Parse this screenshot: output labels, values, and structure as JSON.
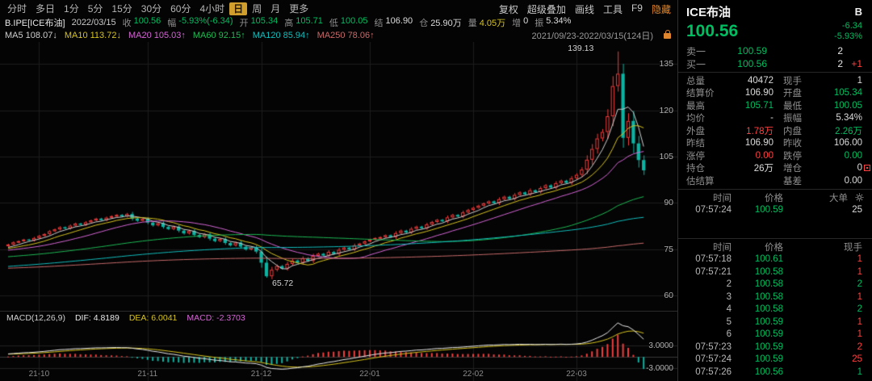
{
  "palette": {
    "up": "#ff4040",
    "down": "#00bd62",
    "flat": "#dcdcdc",
    "warn": "#d7c31f",
    "up_candle": "#f23c3c",
    "down_candle": "#0db3a2",
    "ma5": "#cfcfcf",
    "ma10": "#d7c31f",
    "ma20": "#d465d4",
    "ma60": "#1db954",
    "ma120": "#12bdbd",
    "ma250": "#c66a6a",
    "active_tab_bg": "#cf9e2c",
    "orange": "#e0862e"
  },
  "toolbar": {
    "tabs": [
      "分时",
      "多日",
      "1分",
      "5分",
      "15分",
      "30分",
      "60分",
      "4小时",
      "日",
      "周",
      "月",
      "更多"
    ],
    "active_tab": "日",
    "tools": [
      "复权",
      "超级叠加",
      "画线",
      "工具",
      "F9"
    ],
    "hide_label": "隐藏"
  },
  "infobar": {
    "code": "B.IPE[ICE布油]",
    "date": "2022/03/15",
    "fields": [
      {
        "l": "收",
        "v": "100.56",
        "c": "down"
      },
      {
        "l": "幅",
        "v": "-5.93%(-6.34)",
        "c": "down"
      },
      {
        "l": "开",
        "v": "105.34",
        "c": "down"
      },
      {
        "l": "高",
        "v": "105.71",
        "c": "down"
      },
      {
        "l": "低",
        "v": "100.05",
        "c": "down"
      },
      {
        "l": "结",
        "v": "106.90",
        "c": "flat"
      },
      {
        "l": "仓",
        "v": "25.90万",
        "c": "flat"
      },
      {
        "l": "量",
        "v": "4.05万",
        "c": "warn"
      },
      {
        "l": "增",
        "v": "0",
        "c": "flat"
      },
      {
        "l": "振",
        "v": "5.34%",
        "c": "flat"
      }
    ]
  },
  "ma_row": {
    "items": [
      {
        "label": "MA5",
        "value": "108.07↓",
        "color": "#cfcfcf"
      },
      {
        "label": "MA10",
        "value": "113.72↓",
        "color": "#d7c31f"
      },
      {
        "label": "MA20",
        "value": "105.03↑",
        "color": "#d465d4"
      },
      {
        "label": "MA60",
        "value": "92.15↑",
        "color": "#1db954"
      },
      {
        "label": "MA120",
        "value": "85.94↑",
        "color": "#12bdbd"
      },
      {
        "label": "MA250",
        "value": "78.06↑",
        "color": "#c66a6a"
      }
    ],
    "range": "2021/09/23-2022/03/15(124日)"
  },
  "macd": {
    "title": "MACD(12,26,9)",
    "dif_label": "DIF: 4.8189",
    "dea_label": "DEA: 6.0041",
    "macd_label": "MACD: -2.3703"
  },
  "chart_data": {
    "type": "candlestick",
    "symbol": "ICE布油",
    "period": "日",
    "ylim": [
      55,
      142.2
    ],
    "yticks": [
      135,
      120,
      105,
      90,
      75,
      60
    ],
    "xticks": [
      {
        "label": "21-10",
        "bar": 6
      },
      {
        "label": "21-11",
        "bar": 27
      },
      {
        "label": "21-12",
        "bar": 49
      },
      {
        "label": "22-01",
        "bar": 70
      },
      {
        "label": "22-02",
        "bar": 90
      },
      {
        "label": "22-03",
        "bar": 110
      }
    ],
    "annotations": [
      {
        "label": "139.13",
        "price": 139.13,
        "bar": 118,
        "side": "left"
      },
      {
        "label": "65.72",
        "price": 65.72,
        "bar": 50,
        "side": "right"
      }
    ],
    "first_open": 76.0,
    "closes": [
      76.5,
      77.2,
      77.6,
      78.1,
      77.8,
      78.6,
      79.3,
      79.9,
      80.8,
      81.4,
      82.1,
      81.7,
      82.6,
      83.3,
      82.9,
      83.7,
      84.3,
      84.9,
      84.4,
      85.2,
      85.7,
      86.1,
      85.6,
      86.4,
      84.9,
      84.2,
      84.8,
      83.6,
      82.7,
      83.4,
      82.2,
      81.5,
      82.3,
      81.0,
      80.1,
      80.9,
      79.6,
      78.9,
      79.8,
      78.4,
      77.6,
      78.3,
      77.0,
      76.2,
      77.1,
      75.8,
      74.9,
      75.6,
      74.2,
      70.6,
      66.2,
      68.3,
      69.5,
      68.7,
      70.2,
      71.3,
      70.6,
      72.0,
      71.2,
      72.8,
      73.5,
      72.9,
      74.1,
      73.4,
      74.8,
      75.5,
      74.9,
      76.2,
      76.8,
      77.5,
      78.1,
      78.6,
      78.9,
      79.5,
      78.9,
      80.2,
      81.0,
      80.4,
      81.6,
      82.3,
      81.8,
      83.0,
      83.8,
      84.5,
      84.0,
      85.3,
      86.1,
      85.6,
      86.9,
      87.7,
      88.4,
      89.1,
      89.8,
      90.5,
      89.9,
      91.2,
      92.0,
      91.3,
      92.6,
      93.4,
      92.8,
      94.1,
      93.5,
      94.8,
      95.7,
      95.0,
      96.4,
      97.2,
      96.5,
      98.0,
      99.1,
      100.8,
      104.0,
      107.5,
      110.9,
      113.0,
      118.1,
      127.9,
      131.9,
      111.1,
      116.6,
      109.3,
      103.9,
      100.56
    ],
    "high_override": {
      "index": 118,
      "value": 139.13
    },
    "low_override": {
      "index": 50,
      "value": 65.72
    },
    "pre_history": {
      "start": 62,
      "end": 75.5,
      "bars": 130
    },
    "ma_windows": [
      5,
      10,
      20,
      60,
      120,
      250
    ],
    "macd_yticks": [
      {
        "v": 3,
        "label": "3.0000"
      },
      {
        "v": -3,
        "label": "-3.0000"
      }
    ]
  },
  "panel": {
    "name": "ICE布油",
    "market": "B",
    "last": "100.56",
    "change": "-6.34",
    "change_pct": "-5.93%",
    "quote_rows": [
      {
        "label": "卖一",
        "price": "100.59",
        "pc": "down",
        "lots": "2",
        "extra": "",
        "xc": "flat"
      },
      {
        "label": "买一",
        "price": "100.56",
        "pc": "down",
        "lots": "2",
        "extra": "+1",
        "xc": "up"
      }
    ],
    "stat_rows": [
      {
        "l1": "总量",
        "v1": "40472",
        "c1": "flat",
        "l2": "现手",
        "v2": "1",
        "c2": "flat",
        "icon": false
      },
      {
        "l1": "结算价",
        "v1": "106.90",
        "c1": "flat",
        "l2": "开盘",
        "v2": "105.34",
        "c2": "down",
        "icon": false
      },
      {
        "l1": "最高",
        "v1": "105.71",
        "c1": "down",
        "l2": "最低",
        "v2": "100.05",
        "c2": "down",
        "icon": false
      },
      {
        "l1": "均价",
        "v1": "-",
        "c1": "flat",
        "l2": "振幅",
        "v2": "5.34%",
        "c2": "flat",
        "icon": false
      },
      {
        "l1": "外盘",
        "v1": "1.78万",
        "c1": "up",
        "l2": "内盘",
        "v2": "2.26万",
        "c2": "down",
        "icon": false
      },
      {
        "l1": "昨结",
        "v1": "106.90",
        "c1": "flat",
        "l2": "昨收",
        "v2": "106.00",
        "c2": "flat",
        "icon": false
      },
      {
        "l1": "涨停",
        "v1": "0.00",
        "c1": "up",
        "l2": "跌停",
        "v2": "0.00",
        "c2": "down",
        "icon": false
      },
      {
        "l1": "持仓",
        "v1": "26万",
        "c1": "flat",
        "l2": "增仓",
        "v2": "0",
        "c2": "flat",
        "icon": true
      },
      {
        "l1": "估结算",
        "v1": "",
        "c1": "flat",
        "l2": "基差",
        "v2": "0.00",
        "c2": "flat",
        "icon": false
      }
    ],
    "big_orders": {
      "h1": "时间",
      "h2": "价格",
      "h3": "大单",
      "rows": [
        {
          "t": "07:57:24",
          "p": "100.59",
          "pc": "down",
          "n": "25",
          "nc": "flat"
        }
      ]
    },
    "ticks": {
      "h1": "时间",
      "h2": "价格",
      "h3": "现手",
      "rows": [
        {
          "t": "07:57:18",
          "p": "100.61",
          "pc": "down",
          "n": "1",
          "nc": "up"
        },
        {
          "t": "07:57:21",
          "p": "100.58",
          "pc": "down",
          "n": "1",
          "nc": "up"
        },
        {
          "t": "2",
          "p": "100.58",
          "pc": "down",
          "n": "2",
          "nc": "down"
        },
        {
          "t": "3",
          "p": "100.58",
          "pc": "down",
          "n": "1",
          "nc": "up"
        },
        {
          "t": "4",
          "p": "100.58",
          "pc": "down",
          "n": "2",
          "nc": "down"
        },
        {
          "t": "5",
          "p": "100.59",
          "pc": "down",
          "n": "1",
          "nc": "up"
        },
        {
          "t": "6",
          "p": "100.59",
          "pc": "down",
          "n": "1",
          "nc": "up"
        },
        {
          "t": "07:57:23",
          "p": "100.59",
          "pc": "down",
          "n": "2",
          "nc": "up"
        },
        {
          "t": "07:57:24",
          "p": "100.59",
          "pc": "down",
          "n": "25",
          "nc": "up"
        },
        {
          "t": "07:57:26",
          "p": "100.56",
          "pc": "down",
          "n": "1",
          "nc": "down"
        }
      ]
    }
  }
}
